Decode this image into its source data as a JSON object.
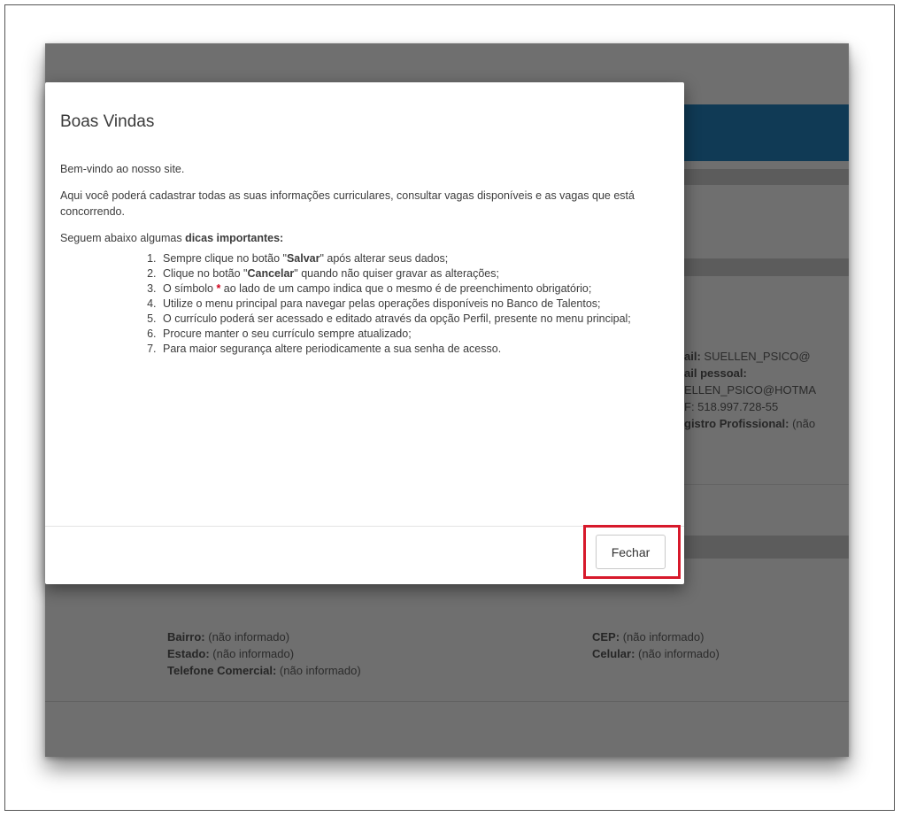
{
  "modal": {
    "title": "Boas Vindas",
    "welcome": "Bem-vindo ao nosso site.",
    "intro": "Aqui você poderá cadastrar todas as suas informações curriculares, consultar vagas disponíveis e as vagas que está concorrendo.",
    "tips_prefix": "Seguem abaixo algumas ",
    "tips_bold": "dicas importantes:",
    "tips": [
      {
        "before": "Sempre clique no botão \"",
        "bold": "Salvar",
        "after": "\" após alterar seus dados;"
      },
      {
        "before": "Clique no botão \"",
        "bold": "Cancelar",
        "after": "\" quando não quiser gravar as alterações;"
      },
      {
        "before": "O símbolo ",
        "req": "*",
        "after": " ao lado de um campo indica que o mesmo é de preenchimento obrigatório;"
      },
      {
        "text": "Utilize o menu principal para navegar pelas operações disponíveis no Banco de Talentos;"
      },
      {
        "text": "O currículo poderá ser acessado e editado através da opção Perfil, presente no menu principal;"
      },
      {
        "text": "Procure manter o seu currículo sempre atualizado;"
      },
      {
        "text": "Para maior segurança altere periodicamente a sua senha de acesso."
      }
    ],
    "close_label": "Fechar"
  },
  "background": {
    "right_fields": {
      "email_label": "ail:",
      "email_value": "SUELLEN_PSICO@",
      "email_pessoal_label": "ail pessoal:",
      "email_pessoal_value": "ELLEN_PSICO@HOTMA",
      "cpf_value": "F: 518.997.728-55",
      "registro_label": "gistro Profissional:",
      "registro_value": "(não"
    },
    "address": {
      "bairro_label": "Bairro:",
      "bairro_value": "(não informado)",
      "estado_label": "Estado:",
      "estado_value": "(não informado)",
      "telefone_label": "Telefone Comercial:",
      "telefone_value": "(não informado)",
      "cep_label": "CEP:",
      "cep_value": "(não informado)",
      "celular_label": "Celular:",
      "celular_value": "(não informado)"
    }
  },
  "colors": {
    "overlay": "#6f6f6f",
    "header_blue": "#103a55",
    "highlight_red": "#d7192b"
  }
}
